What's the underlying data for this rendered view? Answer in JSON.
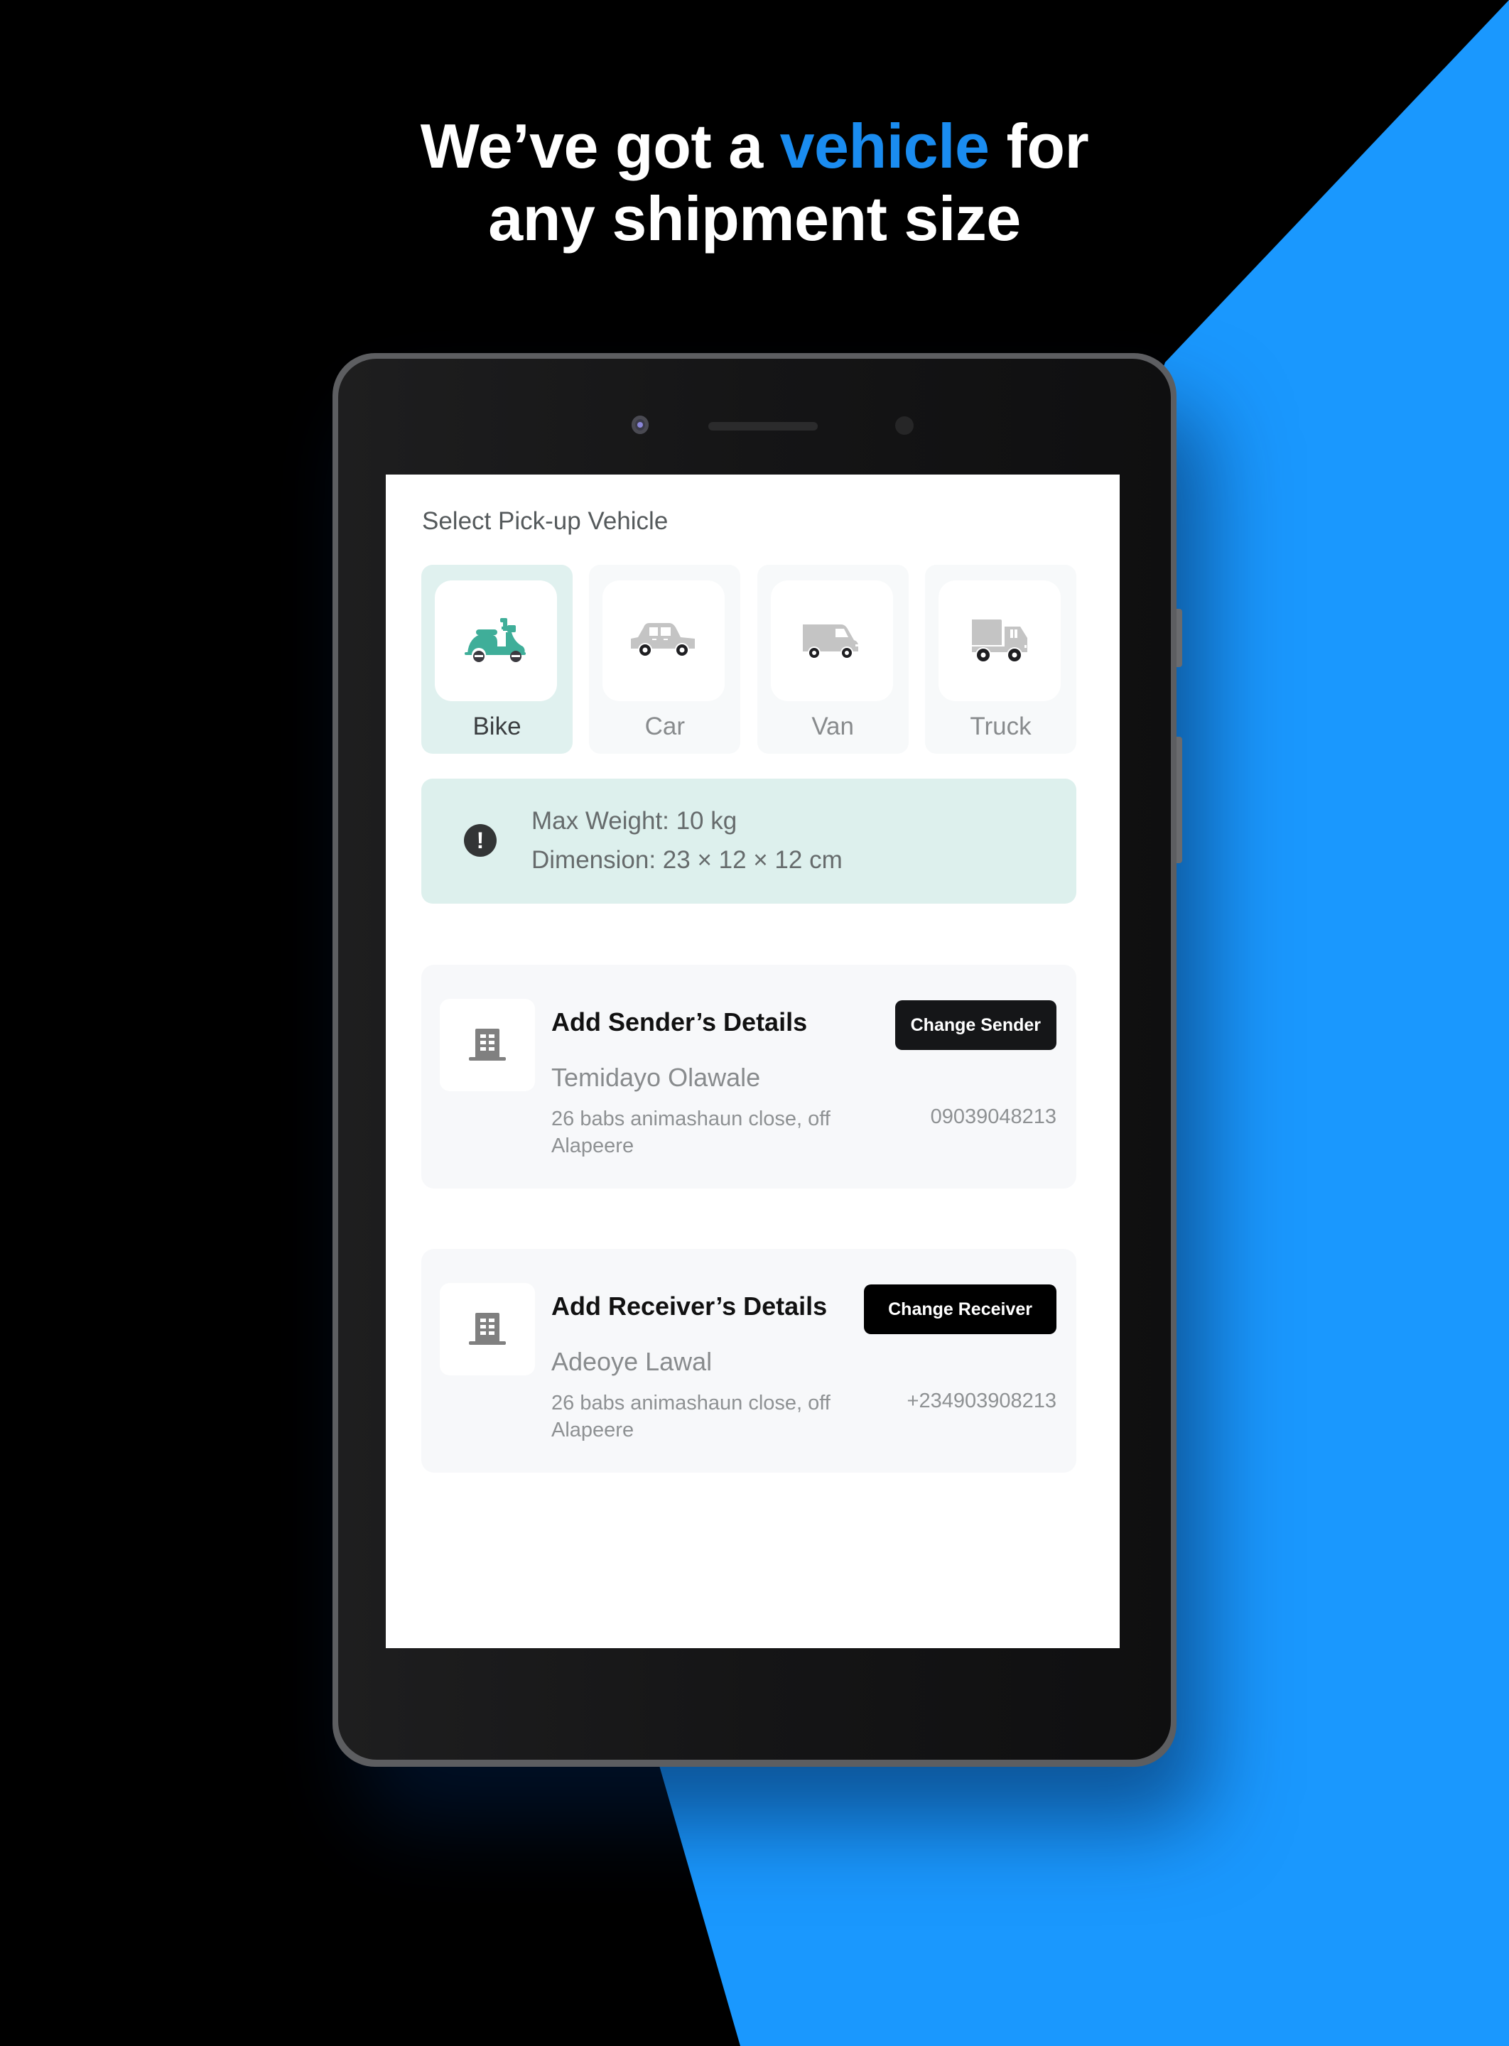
{
  "headline": {
    "line1_before": "We’ve got a ",
    "line1_accent": "vehicle",
    "line1_after": " for",
    "line2": "any shipment size"
  },
  "colors": {
    "background": "#000000",
    "brand_blue": "#1a98fe",
    "accent_text": "#1a8cf0",
    "selected_bg": "#e0f1ef",
    "bike_icon": "#3fae99"
  },
  "screen": {
    "section_title": "Select Pick-up Vehicle",
    "vehicles": [
      {
        "label": "Bike",
        "icon": "scooter-icon",
        "selected": true
      },
      {
        "label": "Car",
        "icon": "car-icon",
        "selected": false
      },
      {
        "label": "Van",
        "icon": "van-icon",
        "selected": false
      },
      {
        "label": "Truck",
        "icon": "truck-icon",
        "selected": false
      }
    ],
    "info": {
      "icon": "alert-icon",
      "max_weight": "Max Weight: 10 kg",
      "dimension": "Dimension: 23 × 12 × 12 cm"
    },
    "sender": {
      "title": "Add Sender’s Details",
      "button": "Change Sender",
      "name": "Temidayo Olawale",
      "address": "26 babs animashaun close, off Alapeere",
      "phone": "09039048213",
      "icon": "building-icon"
    },
    "receiver": {
      "title": "Add Receiver’s Details",
      "button": "Change Receiver",
      "name": "Adeoye Lawal",
      "address": "26 babs animashaun close, off Alapeere",
      "phone": "+234903908213",
      "icon": "building-icon"
    }
  }
}
